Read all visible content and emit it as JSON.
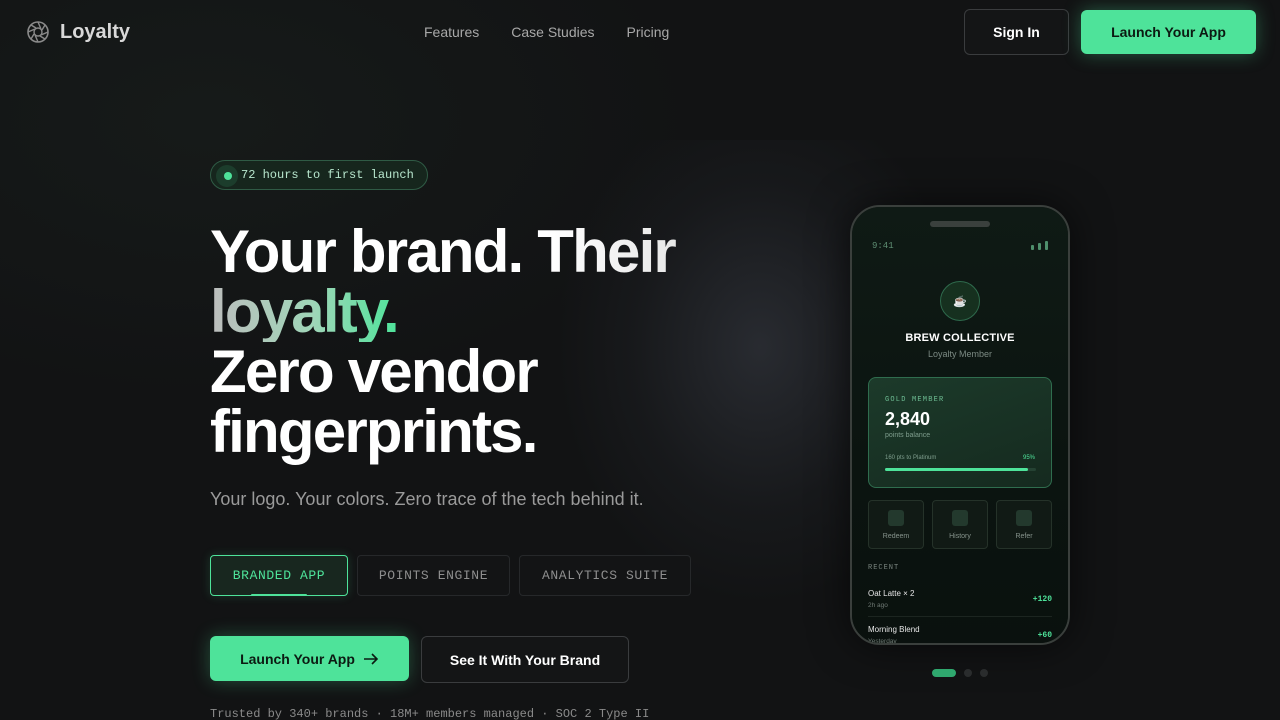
{
  "nav": {
    "logo_text": "Loyalty",
    "links": [
      "Features",
      "Case Studies",
      "Pricing"
    ],
    "sign_in": "Sign In",
    "launch": "Launch Your App"
  },
  "hero": {
    "badge": "72 hours to first launch",
    "headline_line1": "Your brand. Their",
    "headline_line2": "loyalty.",
    "headline_line3": "Zero vendor",
    "headline_line4": "fingerprints.",
    "subtitle": "Your logo. Your colors. Zero trace of the tech behind it.",
    "tabs": [
      {
        "label": "BRANDED APP",
        "active": true
      },
      {
        "label": "POINTS ENGINE",
        "active": false
      },
      {
        "label": "ANALYTICS SUITE",
        "active": false
      }
    ],
    "cta_primary": "Launch Your App",
    "cta_secondary": "See It With Your Brand",
    "trust": "Trusted by 340+ brands · 18M+ members managed · SOC 2 Type II"
  },
  "phone": {
    "time": "9:41",
    "brand": "BREW COLLECTIVE",
    "member_label": "Loyalty Member",
    "card": {
      "tier": "GOLD MEMBER",
      "points": "2,840",
      "points_label": "points balance",
      "progress_text": "160 pts to Platinum",
      "progress_pct": "95%",
      "progress_value": 0.95
    },
    "actions": [
      "Redeem",
      "History",
      "Refer"
    ],
    "recent_label": "RECENT",
    "transactions": [
      {
        "name": "Oat Latte × 2",
        "time": "2h ago",
        "points": "+120"
      },
      {
        "name": "Morning Blend",
        "time": "Yesterday",
        "points": "+60"
      }
    ]
  },
  "carousel": {
    "count": 3,
    "active": 0
  },
  "colors": {
    "accent": "#4ee39a",
    "background": "#121314"
  }
}
